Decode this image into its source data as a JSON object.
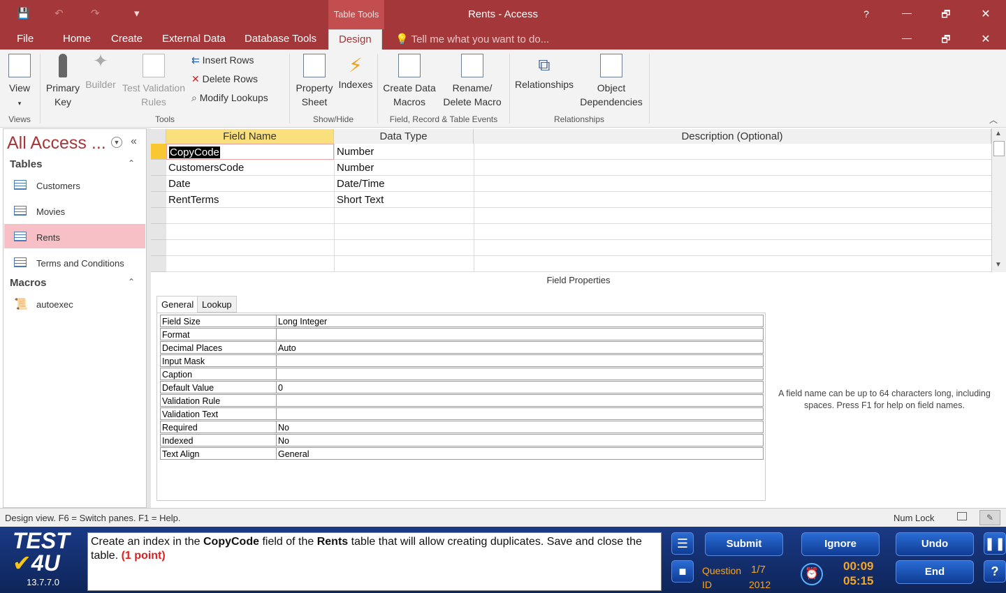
{
  "window": {
    "title": "Rents - Access",
    "context_tab": "Table Tools",
    "help": "?",
    "minimize": "—",
    "restore": "🗗",
    "close": "✕"
  },
  "qat": {
    "save": "💾",
    "undo": "↶",
    "redo": "↷",
    "customize": "▾"
  },
  "tabs": [
    "File",
    "Home",
    "Create",
    "External Data",
    "Database Tools",
    "Design"
  ],
  "active_tab": "Design",
  "tell_me": "Tell me what you want to do...",
  "ribbon": {
    "views": {
      "view": "View",
      "group": "Views"
    },
    "tools": {
      "primary_key": "Primary Key",
      "builder": "Builder",
      "test_validation": "Test Validation Rules",
      "insert_rows": "Insert Rows",
      "delete_rows": "Delete Rows",
      "modify_lookups": "Modify Lookups",
      "group": "Tools"
    },
    "showhide": {
      "property_sheet": "Property Sheet",
      "indexes": "Indexes",
      "group": "Show/Hide"
    },
    "events": {
      "create_macros": "Create Data Macros",
      "rename_macro": "Rename/ Delete Macro",
      "group": "Field, Record & Table Events"
    },
    "relationships": {
      "relationships": "Relationships",
      "dependencies": "Object Dependencies",
      "group": "Relationships"
    }
  },
  "nav": {
    "title": "All Access ...",
    "tables_header": "Tables",
    "tables": [
      "Customers",
      "Movies",
      "Rents",
      "Terms and Conditions"
    ],
    "selected": "Rents",
    "macros_header": "Macros",
    "macros": [
      "autoexec"
    ]
  },
  "design_grid": {
    "headers": [
      "Field Name",
      "Data Type",
      "Description (Optional)"
    ],
    "rows": [
      [
        "CopyCode",
        "Number",
        ""
      ],
      [
        "CustomersCode",
        "Number",
        ""
      ],
      [
        "Date",
        "Date/Time",
        ""
      ],
      [
        "RentTerms",
        "Short Text",
        ""
      ]
    ]
  },
  "field_properties": {
    "title": "Field Properties",
    "tabs": [
      "General",
      "Lookup"
    ],
    "rows": [
      [
        "Field Size",
        "Long Integer"
      ],
      [
        "Format",
        ""
      ],
      [
        "Decimal Places",
        "Auto"
      ],
      [
        "Input Mask",
        ""
      ],
      [
        "Caption",
        ""
      ],
      [
        "Default Value",
        "0"
      ],
      [
        "Validation Rule",
        ""
      ],
      [
        "Validation Text",
        ""
      ],
      [
        "Required",
        "No"
      ],
      [
        "Indexed",
        "No"
      ],
      [
        "Text Align",
        "General"
      ]
    ],
    "help_text": "A field name can be up to 64 characters long, including spaces. Press F1 for help on field names."
  },
  "status": {
    "left": "Design view.  F6 = Switch panes.  F1 = Help.",
    "num_lock": "Num Lock"
  },
  "test4u": {
    "logo_line1": "TEST",
    "logo_line2": "4U",
    "version": "13.7.7.0",
    "question_part1": "Create an index in the ",
    "question_bold1": "CopyCode",
    "question_part2": " field of the ",
    "question_bold2": "Rents",
    "question_part3": " table that will allow creating duplicates. Save and close the table. ",
    "question_points": "(1 point)",
    "buttons": {
      "submit": "Submit",
      "ignore": "Ignore",
      "undo": "Undo",
      "end": "End"
    },
    "question_label": "Question",
    "question_value": "1/7",
    "id_label": "ID",
    "id_value": "2012",
    "timer1": "00:09",
    "timer2": "05:15"
  }
}
